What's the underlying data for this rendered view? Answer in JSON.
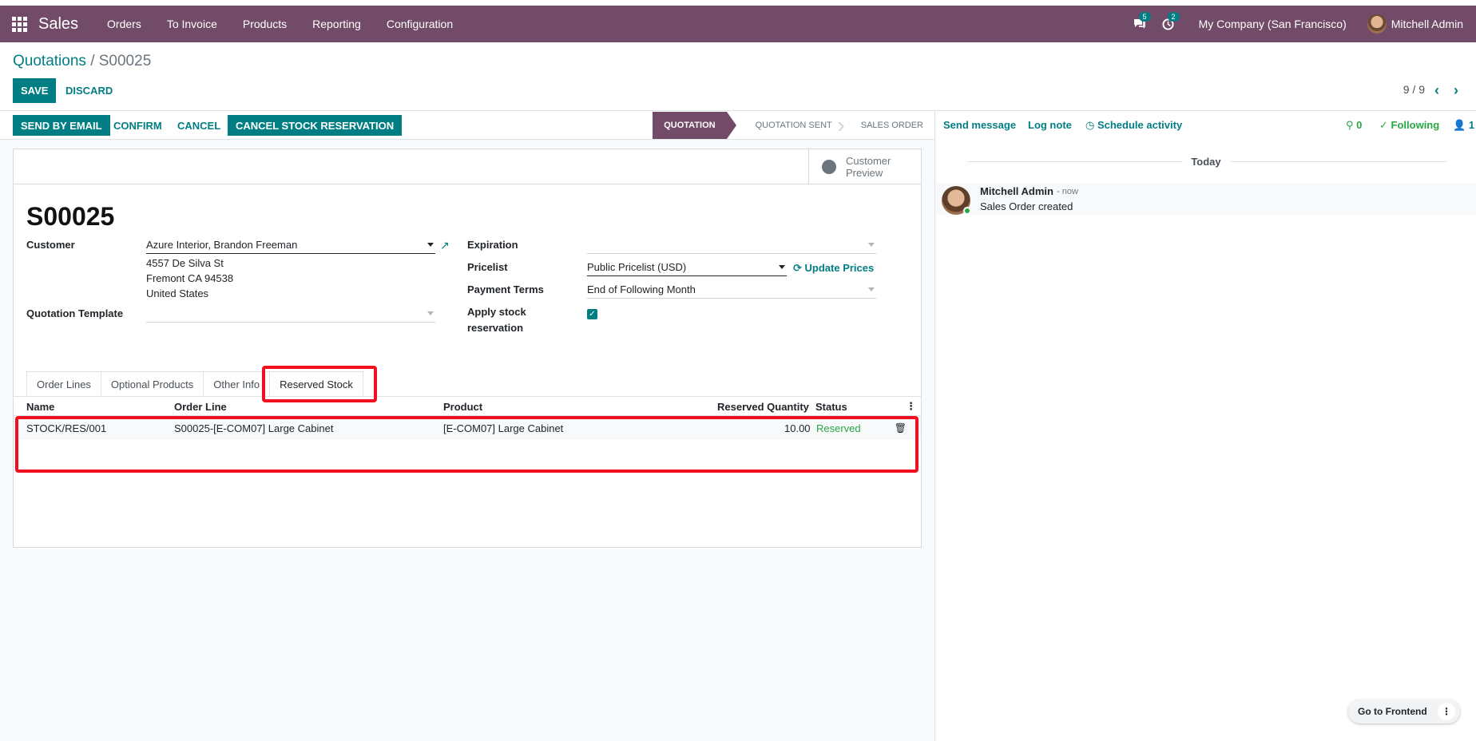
{
  "navbar": {
    "brand": "Sales",
    "menus": [
      "Orders",
      "To Invoice",
      "Products",
      "Reporting",
      "Configuration"
    ],
    "messages_count": "5",
    "activities_count": "2",
    "company": "My Company (San Francisco)",
    "user": "Mitchell Admin",
    "accent_color": "#714B67"
  },
  "control_panel": {
    "breadcrumb_root": "Quotations",
    "breadcrumb_sep": "/",
    "breadcrumb_current": "S00025",
    "save_label": "SAVE",
    "discard_label": "DISCARD",
    "pager": "9 / 9"
  },
  "statusbar": {
    "buttons": [
      "SEND BY EMAIL",
      "CONFIRM",
      "CANCEL",
      "CANCEL STOCK RESERVATION"
    ],
    "stages": [
      "QUOTATION",
      "QUOTATION SENT",
      "SALES ORDER"
    ],
    "active_stage": "QUOTATION"
  },
  "form": {
    "customer_preview_line1": "Customer",
    "customer_preview_line2": "Preview",
    "title": "S00025",
    "customer_label": "Customer",
    "customer_value": "Azure Interior, Brandon Freeman",
    "address_line1": "4557 De Silva St",
    "address_line2": "Fremont CA 94538",
    "address_line3": "United States",
    "quotation_template_label": "Quotation Template",
    "quotation_template_value": "",
    "expiration_label": "Expiration",
    "expiration_value": "",
    "pricelist_label": "Pricelist",
    "pricelist_value": "Public Pricelist (USD)",
    "update_prices": "Update Prices",
    "payment_terms_label": "Payment Terms",
    "payment_terms_value": "End of Following Month",
    "apply_stock_label_1": "Apply stock",
    "apply_stock_label_2": "reservation",
    "apply_stock_checked": true
  },
  "tabs": [
    {
      "label": "Order Lines",
      "active": false
    },
    {
      "label": "Optional Products",
      "active": false
    },
    {
      "label": "Other Info",
      "active": false
    },
    {
      "label": "Reserved Stock",
      "active": true
    }
  ],
  "reserved_table": {
    "headers": [
      "Name",
      "Order Line",
      "Product",
      "Reserved Quantity",
      "Status"
    ],
    "rows": [
      {
        "name": "STOCK/RES/001",
        "order_line": "S00025-[E-COM07] Large Cabinet",
        "product": "[E-COM07] Large Cabinet",
        "quantity": "10.00",
        "status": "Reserved"
      }
    ]
  },
  "chatter": {
    "send_message": "Send message",
    "log_note": "Log note",
    "schedule_activity": "Schedule activity",
    "attachments_count": "0",
    "following": "Following",
    "followers_count": "1",
    "date_separator": "Today",
    "message_author": "Mitchell Admin",
    "message_time": "- now",
    "message_body": "Sales Order created"
  },
  "frontend_button": "Go to Frontend"
}
